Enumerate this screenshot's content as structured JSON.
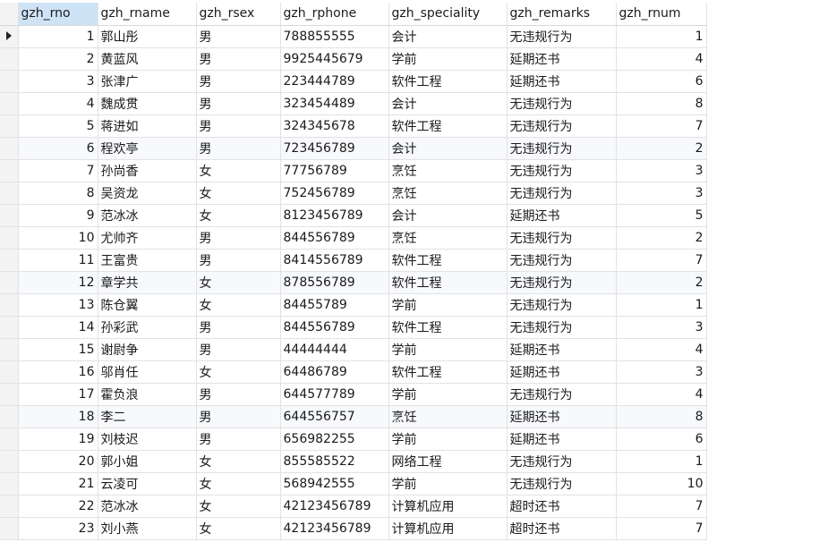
{
  "table": {
    "columns": [
      "gzh_rno",
      "gzh_rname",
      "gzh_rsex",
      "gzh_rphone",
      "gzh_speciality",
      "gzh_remarks",
      "gzh_rnum"
    ],
    "rows": [
      [
        "1",
        "郭山彤",
        "男",
        "788855555",
        "会计",
        "无违规行为",
        "1"
      ],
      [
        "2",
        "黄蓝风",
        "男",
        "9925445679",
        "学前",
        "延期还书",
        "4"
      ],
      [
        "3",
        "张津广",
        "男",
        "223444789",
        "软件工程",
        "延期还书",
        "6"
      ],
      [
        "4",
        "魏成贯",
        "男",
        "323454489",
        "会计",
        "无违规行为",
        "8"
      ],
      [
        "5",
        "蒋进如",
        "男",
        "324345678",
        "软件工程",
        "无违规行为",
        "7"
      ],
      [
        "6",
        "程欢亭",
        "男",
        "723456789",
        "会计",
        "无违规行为",
        "2"
      ],
      [
        "7",
        "孙尚香",
        "女",
        "77756789",
        "烹饪",
        "无违规行为",
        "3"
      ],
      [
        "8",
        "吴资龙",
        "女",
        "752456789",
        "烹饪",
        "无违规行为",
        "3"
      ],
      [
        "9",
        "范冰冰",
        "女",
        "8123456789",
        "会计",
        "延期还书",
        "5"
      ],
      [
        "10",
        "尤帅齐",
        "男",
        "844556789",
        "烹饪",
        "无违规行为",
        "2"
      ],
      [
        "11",
        "王富贵",
        "男",
        "8414556789",
        "软件工程",
        "无违规行为",
        "7"
      ],
      [
        "12",
        "章学共",
        "女",
        "878556789",
        "软件工程",
        "无违规行为",
        "2"
      ],
      [
        "13",
        "陈仓翼",
        "女",
        "84455789",
        "学前",
        "无违规行为",
        "1"
      ],
      [
        "14",
        "孙彩武",
        "男",
        "844556789",
        "软件工程",
        "无违规行为",
        "3"
      ],
      [
        "15",
        "谢尉争",
        "男",
        "44444444",
        "学前",
        "延期还书",
        "4"
      ],
      [
        "16",
        "邬肖任",
        "女",
        "64486789",
        "软件工程",
        "延期还书",
        "3"
      ],
      [
        "17",
        "霍负浪",
        "男",
        "644577789",
        "学前",
        "无违规行为",
        "4"
      ],
      [
        "18",
        "李二",
        "男",
        "644556757",
        "烹饪",
        "延期还书",
        "8"
      ],
      [
        "19",
        "刘枝迟",
        "男",
        "656982255",
        "学前",
        "延期还书",
        "6"
      ],
      [
        "20",
        "郭小姐",
        "女",
        "855585522",
        "网络工程",
        "无违规行为",
        "1"
      ],
      [
        "21",
        "云凌可",
        "女",
        "568942555",
        "学前",
        "无违规行为",
        "10"
      ],
      [
        "22",
        "范冰冰",
        "女",
        "42123456789",
        "计算机应用",
        "超时还书",
        "7"
      ],
      [
        "23",
        "刘小燕",
        "女",
        "42123456789",
        "计算机应用",
        "超时还书",
        "7"
      ]
    ]
  },
  "current_row_indicator": "row-pointer-arrow-icon",
  "colors": {
    "header_sorted_bg": "#cfe3f7",
    "row_stripe_bg": "#f7f9fc",
    "indicator_bg": "#f3f3f3",
    "grid_line": "#e2e2e2"
  }
}
